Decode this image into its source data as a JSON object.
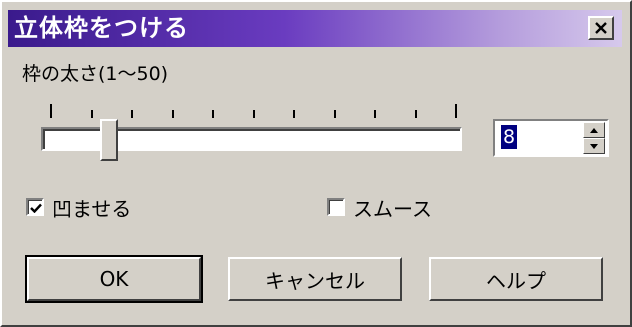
{
  "window": {
    "title": "立体枠をつける"
  },
  "border_width": {
    "label": "枠の太さ(1～50)",
    "min": 1,
    "max": 50,
    "value": "8",
    "tick_count": 11
  },
  "options": {
    "emboss_label": "凹ませる",
    "emboss_checked": true,
    "smooth_label": "スムース",
    "smooth_checked": false
  },
  "buttons": {
    "ok": "OK",
    "cancel": "キャンセル",
    "help": "ヘルプ"
  },
  "colors": {
    "titlebar_start": "#3a1a8c",
    "titlebar_end": "#d6c9ec",
    "face": "#d4d0c8",
    "selection": "#000080"
  }
}
